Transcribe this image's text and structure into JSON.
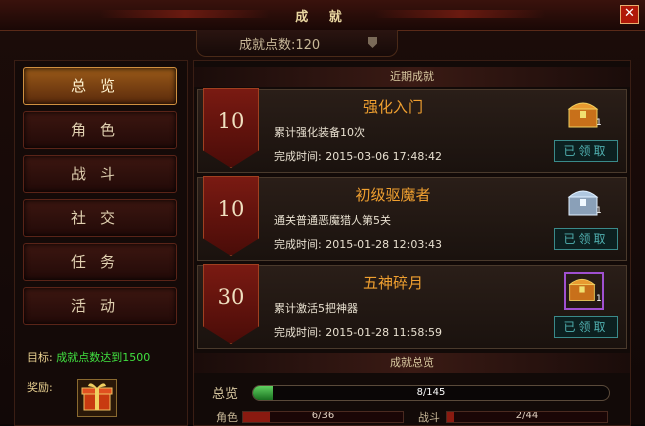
{
  "window": {
    "title": "成 就",
    "close_label": "✕"
  },
  "points": {
    "label": "成就点数:120"
  },
  "nav": [
    {
      "label": "总览",
      "active": true
    },
    {
      "label": "角色",
      "active": false
    },
    {
      "label": "战斗",
      "active": false
    },
    {
      "label": "社交",
      "active": false
    },
    {
      "label": "任务",
      "active": false
    },
    {
      "label": "活动",
      "active": false
    }
  ],
  "goal": {
    "label": "目标:",
    "value": "成就点数达到1500"
  },
  "reward": {
    "label": "奖励:"
  },
  "recent": {
    "header": "近期成就",
    "items": [
      {
        "points": "10",
        "name": "强化入门",
        "desc": "累计强化装备10次",
        "time": "完成时间: 2015-03-06 17:48:42",
        "count": "1",
        "status": "已领取",
        "chest": "gold-chest-icon"
      },
      {
        "points": "10",
        "name": "初级驱魔者",
        "desc": "通关普通恶魔猎人第5关",
        "time": "完成时间: 2015-01-28 12:03:43",
        "count": "1",
        "status": "已领取",
        "chest": "silver-chest-icon"
      },
      {
        "points": "30",
        "name": "五神碎月",
        "desc": "累计激活5把神器",
        "time": "完成时间: 2015-01-28 11:58:59",
        "count": "1",
        "status": "已领取",
        "chest": "gold-chest-icon"
      }
    ]
  },
  "summary": {
    "header": "成就总览",
    "total_label": "总览",
    "total_value": "8/145",
    "total_fraction": 0.055,
    "role_label": "角色",
    "role_value": "6/36",
    "role_fraction": 0.167,
    "battle_label": "战斗",
    "battle_value": "2/44",
    "battle_fraction": 0.045
  },
  "colors": {
    "accent": "#f0a030",
    "progress": "#40c040",
    "claimed": "#50b0b0"
  }
}
